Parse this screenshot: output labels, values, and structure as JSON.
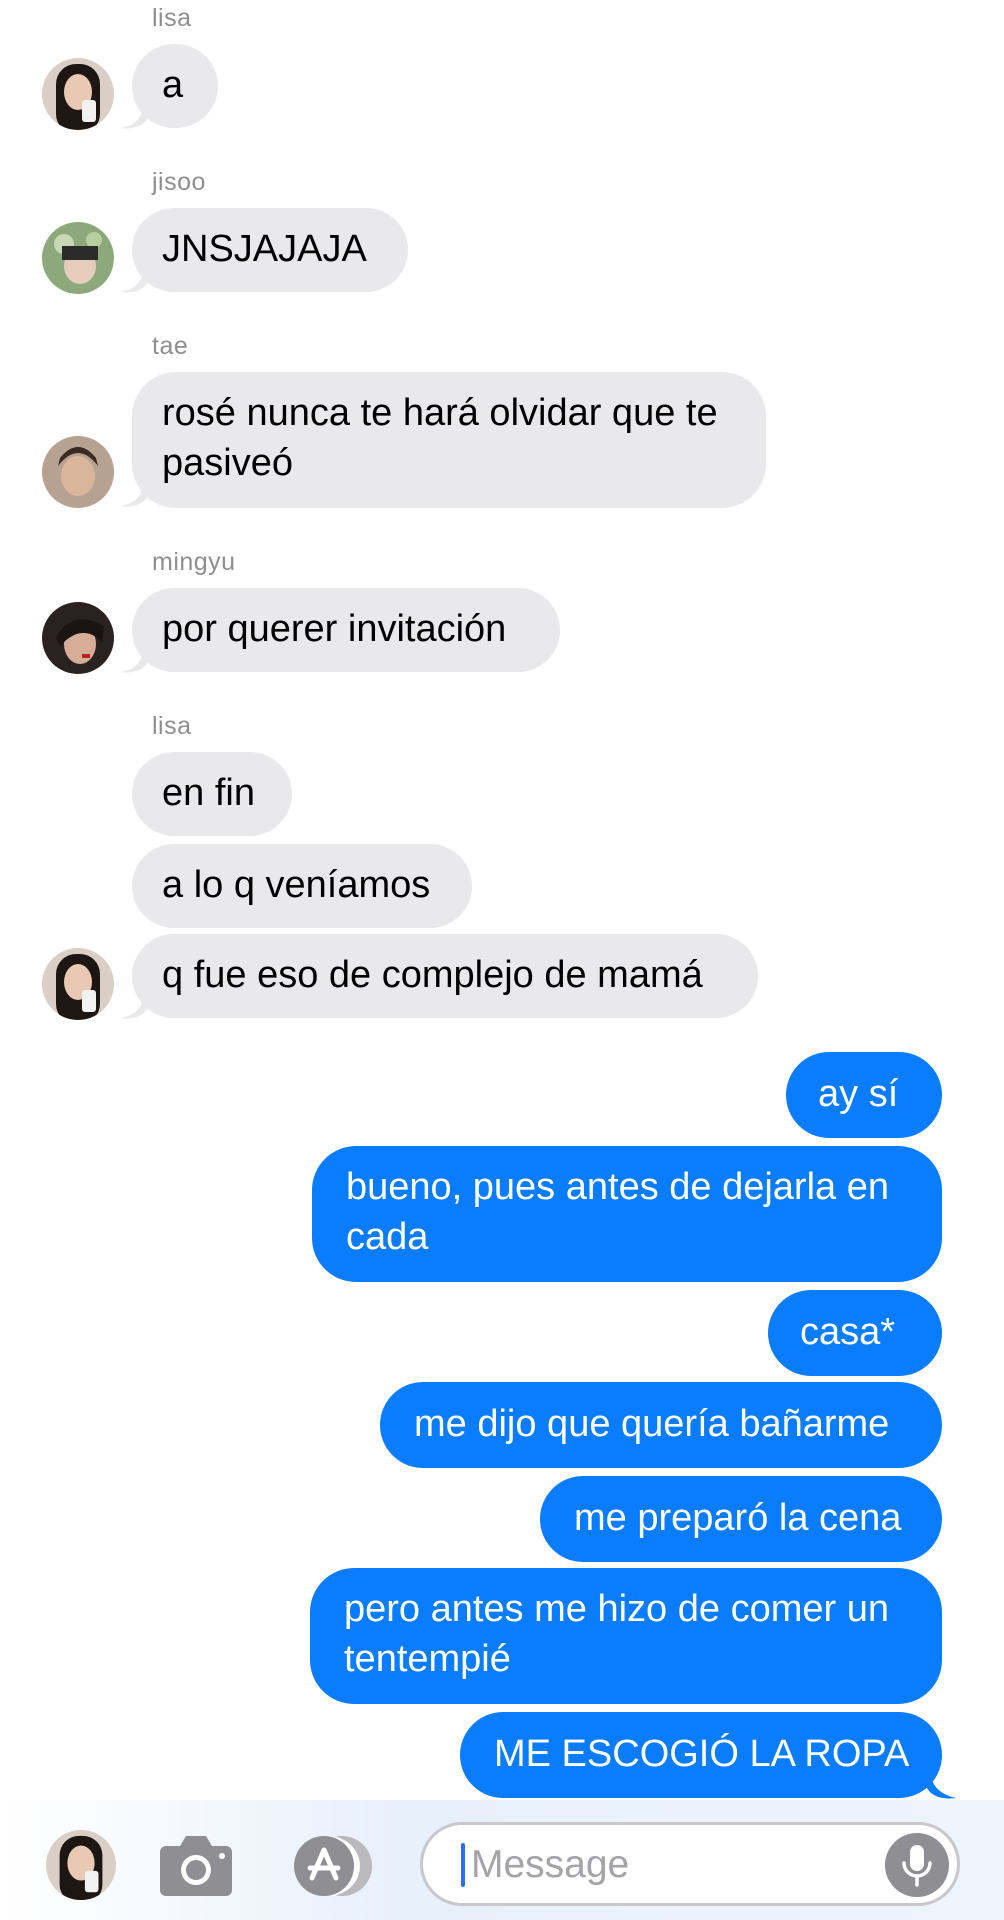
{
  "messages": [
    {
      "sender": "lisa",
      "bubbles": [
        "a"
      ]
    },
    {
      "sender": "jisoo",
      "bubbles": [
        "JNSJAJAJA"
      ]
    },
    {
      "sender": "tae",
      "bubbles": [
        "rosé nunca te hará olvidar que te pasiveó"
      ]
    },
    {
      "sender": "mingyu",
      "bubbles": [
        "por querer invitación"
      ]
    },
    {
      "sender": "lisa",
      "bubbles": [
        "en fin",
        "a lo q veníamos",
        "q fue eso de complejo de mamá"
      ]
    }
  ],
  "outgoing": [
    "ay sí",
    "bueno, pues antes de dejarla en cada",
    "casa*",
    "me dijo que quería bañarme",
    "me preparó la cena",
    "pero antes me hizo de comer un tentempié",
    "ME ESCOGIÓ LA ROPA"
  ],
  "composer": {
    "placeholder": "Message",
    "camera_icon": "camera-icon",
    "apps_icon": "app-store-icon",
    "mic_icon": "microphone-icon"
  },
  "colors": {
    "incoming_bubble": "#e9e9eb",
    "outgoing_bubble": "#0a7cff",
    "sender_label": "#8e8e93"
  }
}
